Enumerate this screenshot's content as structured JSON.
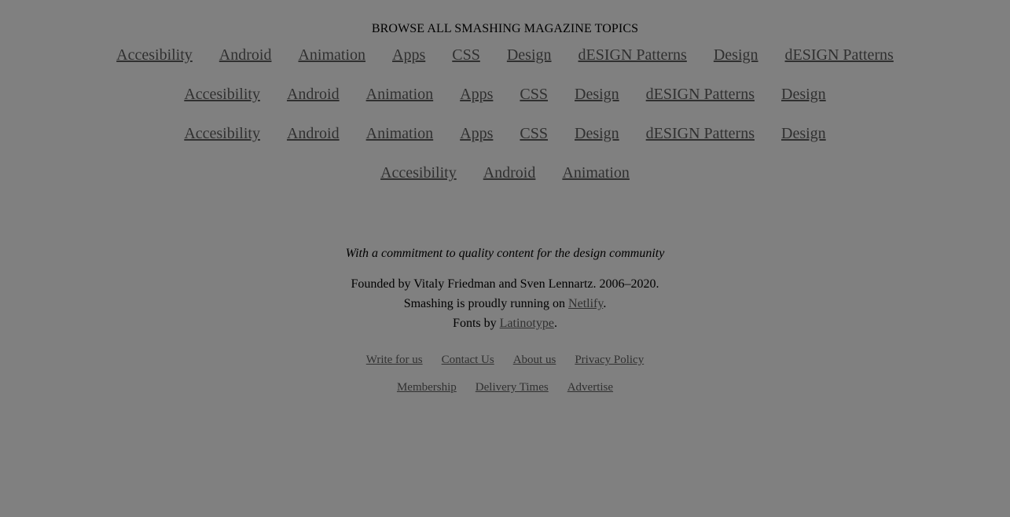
{
  "topics": {
    "heading": "BROWSE ALL SMASHING MAGAZINE TOPICS",
    "rows": [
      [
        "Accesibility",
        "Android",
        "Animation",
        "Apps",
        "CSS",
        "Design",
        "dESIGN Patterns",
        "Design",
        "dESIGN Patterns"
      ],
      [
        "Accesibility",
        "Android",
        "Animation",
        "Apps",
        "CSS",
        "Design",
        "dESIGN Patterns",
        "Design"
      ],
      [
        "Accesibility",
        "Android",
        "Animation",
        "Apps",
        "CSS",
        "Design",
        "dESIGN Patterns",
        "Design"
      ],
      [
        "Accesibility",
        "Android",
        "Animation"
      ]
    ]
  },
  "footer": {
    "tagline": "With a commitment to quality content for the design community",
    "founded": "Founded by Vitaly Friedman and Sven Lennartz. 2006–2020.",
    "running_prefix": "Smashing is proudly running on ",
    "running_link": "Netlify",
    "running_suffix": ".",
    "fonts_prefix": "Fonts by ",
    "fonts_link": "Latinotype",
    "fonts_suffix": ".",
    "nav_row1": [
      "Write for us",
      "Contact Us",
      "About us",
      "Privacy Policy"
    ],
    "nav_row2": [
      "Membership",
      "Delivery Times",
      "Advertise"
    ]
  }
}
